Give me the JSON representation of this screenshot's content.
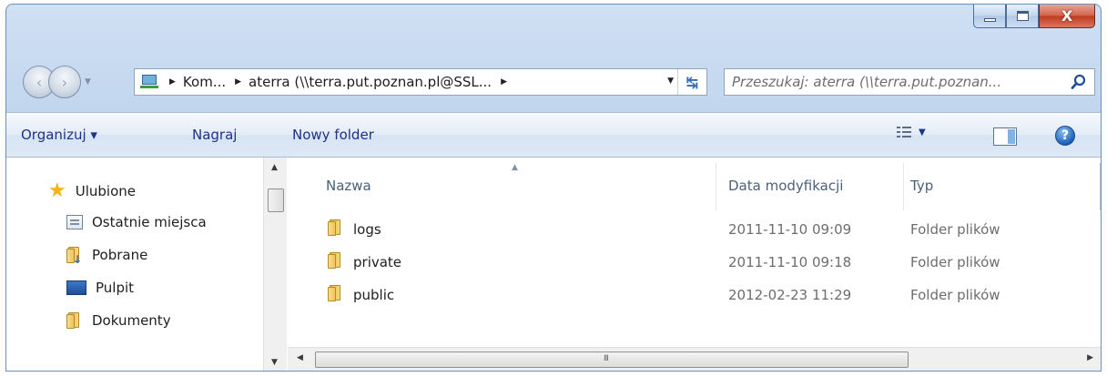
{
  "window": {
    "caption_close": "X"
  },
  "navigation": {
    "back_label": "‹",
    "forward_label": "›",
    "breadcrumb": [
      {
        "label": "Kom..."
      },
      {
        "label": "aterra (\\\\terra.put.poznan.pl@SSL..."
      }
    ],
    "crumb_arrow": "▶",
    "dropdown_arrow": "▼",
    "refresh_icon": "↹",
    "search_placeholder": "Przeszukaj: aterra (\\\\terra.put.poznan..."
  },
  "toolbar": {
    "organize": "Organizuj ▾",
    "burn": "Nagraj",
    "new_folder": "Nowy folder",
    "view_caret": "▼",
    "help": "?"
  },
  "sidebar": {
    "items": [
      {
        "label": "Ulubione",
        "icon": "star-icon"
      },
      {
        "label": "Ostatnie miejsca",
        "icon": "recent-places-icon"
      },
      {
        "label": "Pobrane",
        "icon": "downloads-folder-icon"
      },
      {
        "label": "Pulpit",
        "icon": "desktop-icon"
      },
      {
        "label": "Dokumenty",
        "icon": "folder-icon"
      }
    ]
  },
  "file_list": {
    "columns": [
      "Nazwa",
      "Data modyfikacji",
      "Typ"
    ],
    "rows": [
      {
        "name": "logs",
        "date": "2011-11-10 09:09",
        "type": "Folder plików"
      },
      {
        "name": "private",
        "date": "2011-11-10 09:18",
        "type": "Folder plików"
      },
      {
        "name": "public",
        "date": "2012-02-23 11:29",
        "type": "Folder plików"
      }
    ]
  },
  "scrollbar": {
    "grip": "III"
  },
  "colors": {
    "accent_text": "#1e3287",
    "frame": "#bcd2ec",
    "close_button": "#c0391d"
  }
}
